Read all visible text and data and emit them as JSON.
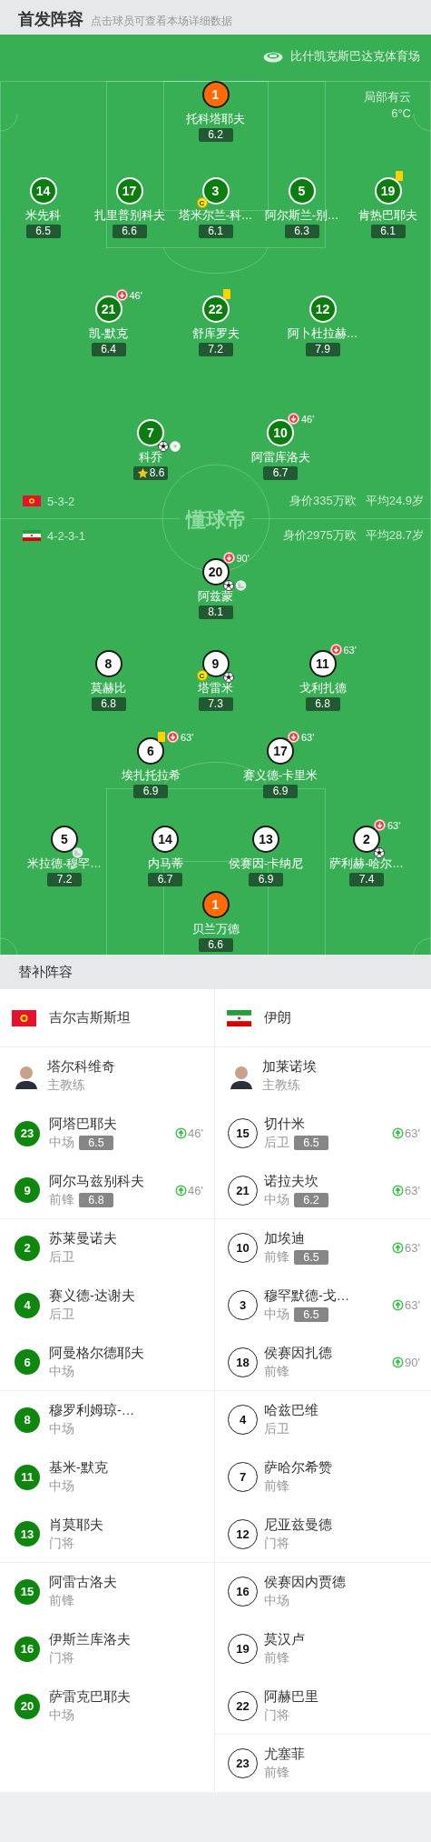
{
  "header": {
    "title": "首发阵容",
    "hint": "点击球员可查看本场详细数据"
  },
  "pitch": {
    "stadium": "比什凯克斯巴达克体育场",
    "weather": "局部有云",
    "temperature": "6°C",
    "logo": "懂球帝",
    "teams": [
      {
        "kind": "home",
        "flag": {
          "kind": "kyrgyzstan"
        },
        "formation": "5-3-2",
        "value": "身价335万欧",
        "average_age": "平均24.9岁",
        "lines": [
          {
            "players": [
              {
                "number": "1",
                "name": "托科塔耶夫",
                "rating": "6.2",
                "kind": "goalkeeper"
              }
            ]
          },
          {
            "players": [
              {
                "number": "14",
                "name": "米先科",
                "rating": "6.5",
                "kind": "outfield"
              },
              {
                "number": "17",
                "name": "扎里普别科夫",
                "rating": "6.6",
                "kind": "outfield"
              },
              {
                "number": "3",
                "name": "塔米尔兰-科…",
                "rating": "6.1",
                "kind": "outfield",
                "captain": "C"
              },
              {
                "number": "5",
                "name": "阿尔斯兰-别…",
                "rating": "6.3",
                "kind": "outfield"
              },
              {
                "number": "19",
                "name": "肯热巴耶夫",
                "rating": "6.1",
                "kind": "outfield",
                "yellow_card": true
              }
            ]
          },
          {
            "players": [
              {
                "number": "21",
                "name": "凯-默克",
                "rating": "6.4",
                "kind": "outfield",
                "sub_off": "46'"
              },
              {
                "number": "22",
                "name": "舒库罗夫",
                "rating": "7.2",
                "kind": "outfield",
                "yellow_card": true
              },
              {
                "number": "12",
                "name": "阿卜杜拉赫…",
                "rating": "7.9",
                "kind": "outfield"
              }
            ]
          },
          {
            "players": [
              {
                "number": "7",
                "name": "科乔",
                "rating": "8.6",
                "kind": "outfield",
                "motm": true,
                "marks": [
                  {
                    "kind": "goal"
                  },
                  {
                    "kind": "goal_faint"
                  }
                ]
              },
              {
                "number": "10",
                "name": "阿雷库洛夫",
                "rating": "6.7",
                "kind": "outfield",
                "sub_off": "46'"
              }
            ]
          }
        ]
      },
      {
        "kind": "away",
        "flag": {
          "kind": "iran"
        },
        "formation": "4-2-3-1",
        "value": "身价2975万欧",
        "average_age": "平均28.7岁",
        "lines": [
          {
            "players": [
              {
                "number": "20",
                "name": "阿兹蒙",
                "rating": "8.1",
                "kind": "outfield",
                "sub_off": "90'",
                "marks": [
                  {
                    "kind": "goal"
                  },
                  {
                    "kind": "assist"
                  }
                ]
              }
            ]
          },
          {
            "players": [
              {
                "number": "8",
                "name": "莫赫比",
                "rating": "6.8",
                "kind": "outfield"
              },
              {
                "number": "9",
                "name": "塔雷米",
                "rating": "7.3",
                "kind": "outfield",
                "captain": "C",
                "marks": [
                  {
                    "kind": "goal"
                  }
                ]
              },
              {
                "number": "11",
                "name": "戈利扎德",
                "rating": "6.8",
                "kind": "outfield",
                "sub_off": "63'"
              }
            ]
          },
          {
            "players": [
              {
                "number": "6",
                "name": "埃扎托拉希",
                "rating": "6.9",
                "kind": "outfield",
                "yellow_card": true,
                "sub_off": "63'"
              },
              {
                "number": "17",
                "name": "赛义德-卡里米",
                "rating": "6.9",
                "kind": "outfield",
                "sub_off": "63'"
              }
            ]
          },
          {
            "players": [
              {
                "number": "5",
                "name": "米拉德-穆罕…",
                "rating": "7.2",
                "kind": "outfield",
                "marks": [
                  {
                    "kind": "assist"
                  }
                ]
              },
              {
                "number": "14",
                "name": "内马蒂",
                "rating": "6.7",
                "kind": "outfield"
              },
              {
                "number": "13",
                "name": "侯赛因-卡纳尼",
                "rating": "6.9",
                "kind": "outfield"
              },
              {
                "number": "2",
                "name": "萨利赫-哈尔…",
                "rating": "7.4",
                "kind": "outfield",
                "sub_off": "63'",
                "marks": [
                  {
                    "kind": "goal"
                  }
                ]
              }
            ]
          },
          {
            "players": [
              {
                "number": "1",
                "name": "贝兰万德",
                "rating": "6.6",
                "kind": "goalkeeper"
              }
            ]
          }
        ]
      }
    ]
  },
  "subs": {
    "title": "替补阵容",
    "teams": [
      {
        "kind": "home",
        "flag": {
          "kind": "kyrgyzstan"
        },
        "name": "吉尔吉斯斯坦",
        "coach": {
          "name": "塔尔科维奇",
          "role": "主教练"
        },
        "players": [
          {
            "number": "23",
            "name": "阿塔巴耶夫",
            "position": "中场",
            "rating": "6.5",
            "sub_on": "46'"
          },
          {
            "number": "9",
            "name": "阿尔马兹别科夫",
            "position": "前锋",
            "rating": "6.8",
            "sub_on": "46'"
          },
          {
            "number": "2",
            "name": "苏莱曼诺夫",
            "position": "后卫"
          },
          {
            "number": "4",
            "name": "赛义德-达谢夫",
            "position": "后卫"
          },
          {
            "number": "6",
            "name": "阿曼格尔德耶夫",
            "position": "中场"
          },
          {
            "number": "8",
            "name": "穆罗利姆琼-…",
            "position": "中场"
          },
          {
            "number": "11",
            "name": "基米-默克",
            "position": "中场"
          },
          {
            "number": "13",
            "name": "肖莫耶夫",
            "position": "门将"
          },
          {
            "number": "15",
            "name": "阿雷古洛夫",
            "position": "前锋"
          },
          {
            "number": "16",
            "name": "伊斯兰库洛夫",
            "position": "门将"
          },
          {
            "number": "20",
            "name": "萨雷克巴耶夫",
            "position": "中场"
          }
        ]
      },
      {
        "kind": "away",
        "flag": {
          "kind": "iran"
        },
        "name": "伊朗",
        "coach": {
          "name": "加莱诺埃",
          "role": "主教练"
        },
        "players": [
          {
            "number": "15",
            "name": "切什米",
            "position": "后卫",
            "rating": "6.5",
            "sub_on": "63'"
          },
          {
            "number": "21",
            "name": "诺拉夫坎",
            "position": "中场",
            "rating": "6.2",
            "sub_on": "63'"
          },
          {
            "number": "10",
            "name": "加埃迪",
            "position": "前锋",
            "rating": "6.5",
            "sub_on": "63'"
          },
          {
            "number": "3",
            "name": "穆罕默德-戈…",
            "position": "中场",
            "rating": "6.5",
            "sub_on": "63'"
          },
          {
            "number": "18",
            "name": "侯赛因扎德",
            "position": "前锋",
            "sub_on": "90'"
          },
          {
            "number": "4",
            "name": "哈兹巴维",
            "position": "后卫"
          },
          {
            "number": "7",
            "name": "萨哈尔希赞",
            "position": "前锋"
          },
          {
            "number": "12",
            "name": "尼亚兹曼德",
            "position": "门将"
          },
          {
            "number": "16",
            "name": "侯赛因内贾德",
            "position": "中场"
          },
          {
            "number": "19",
            "name": "莫汉卢",
            "position": "前锋"
          },
          {
            "number": "22",
            "name": "阿赫巴里",
            "position": "门将"
          },
          {
            "number": "23",
            "name": "尤塞菲",
            "position": "前锋"
          }
        ]
      }
    ]
  }
}
